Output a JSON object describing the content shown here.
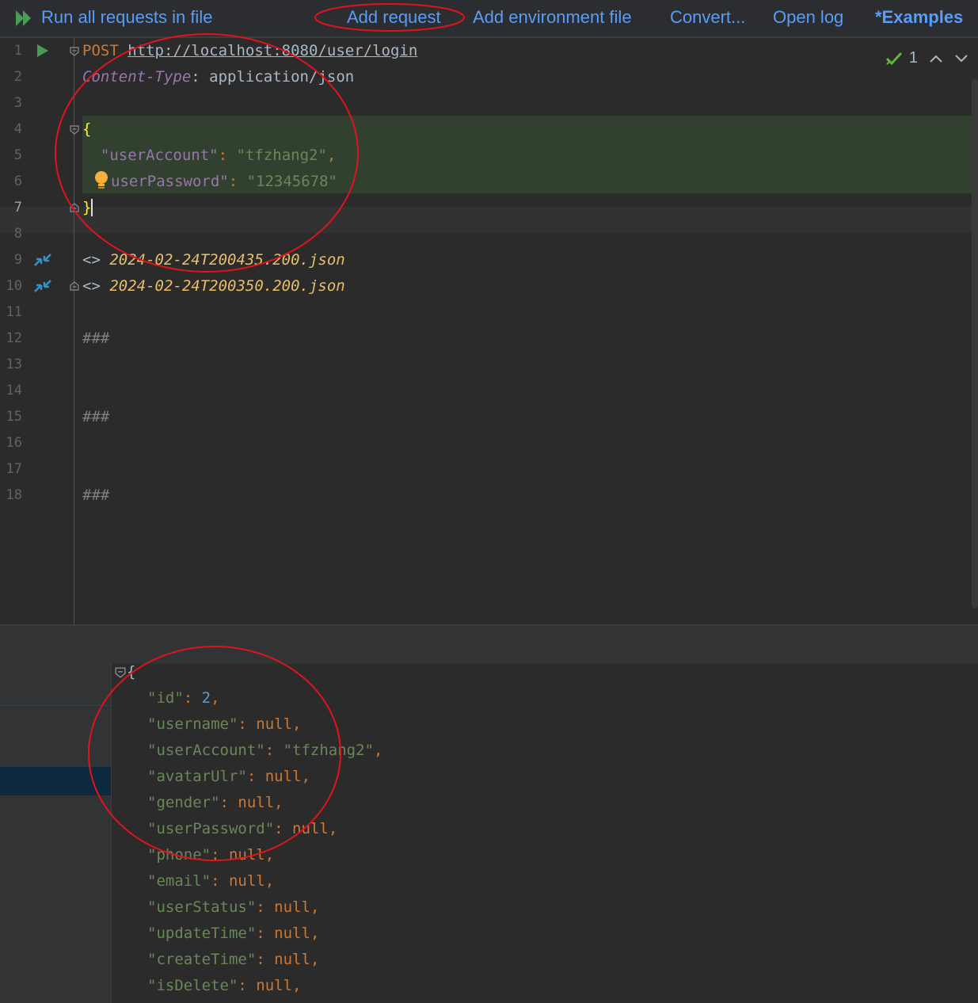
{
  "toolbar": {
    "run_all": "Run all requests in file",
    "add_request": "Add request",
    "add_env": "Add environment file",
    "convert": "Convert...",
    "open_log": "Open log",
    "examples": "*Examples"
  },
  "status": {
    "check_count": "1"
  },
  "editor": {
    "line_numbers": [
      "1",
      "2",
      "3",
      "4",
      "5",
      "6",
      "7",
      "8",
      "9",
      "10",
      "11",
      "12",
      "13",
      "14",
      "15",
      "16",
      "17",
      "18"
    ],
    "method": "POST",
    "url": "http://localhost:8080/user/login",
    "header_name": "Content-Type",
    "header_sep": ": ",
    "header_value": "application/json",
    "open_brace": "{",
    "close_brace": "}",
    "body_key_1": "\"userAccount\"",
    "body_val_1": "\"tfzhang2\"",
    "body_key_2": "userPassword\"",
    "body_val_2": "\"12345678\"",
    "file_prefix": "<> ",
    "file_1": "2024-02-24T200435.200.json",
    "file_2": "2024-02-24T200350.200.json",
    "separator": "###"
  },
  "response": {
    "open_brace": "{",
    "lines": [
      {
        "key": "\"id\"",
        "value": "2",
        "type": "num"
      },
      {
        "key": "\"username\"",
        "value": "null",
        "type": "nul"
      },
      {
        "key": "\"userAccount\"",
        "value": "\"tfzhang2\"",
        "type": "str"
      },
      {
        "key": "\"avatarUlr\"",
        "value": "null",
        "type": "nul"
      },
      {
        "key": "\"gender\"",
        "value": "null",
        "type": "nul"
      },
      {
        "key": "\"userPassword\"",
        "value": "null",
        "type": "nul"
      },
      {
        "key": "\"phone\"",
        "value": "null",
        "type": "nul"
      },
      {
        "key": "\"email\"",
        "value": "null",
        "type": "nul"
      },
      {
        "key": "\"userStatus\"",
        "value": "null",
        "type": "nul"
      },
      {
        "key": "\"updateTime\"",
        "value": "null",
        "type": "nul"
      },
      {
        "key": "\"createTime\"",
        "value": "null",
        "type": "nul"
      },
      {
        "key": "\"isDelete\"",
        "value": "null",
        "type": "nul"
      }
    ]
  },
  "colors": {
    "accent": "#589df6",
    "annotation": "#e0141e",
    "run_green": "#499c54"
  }
}
